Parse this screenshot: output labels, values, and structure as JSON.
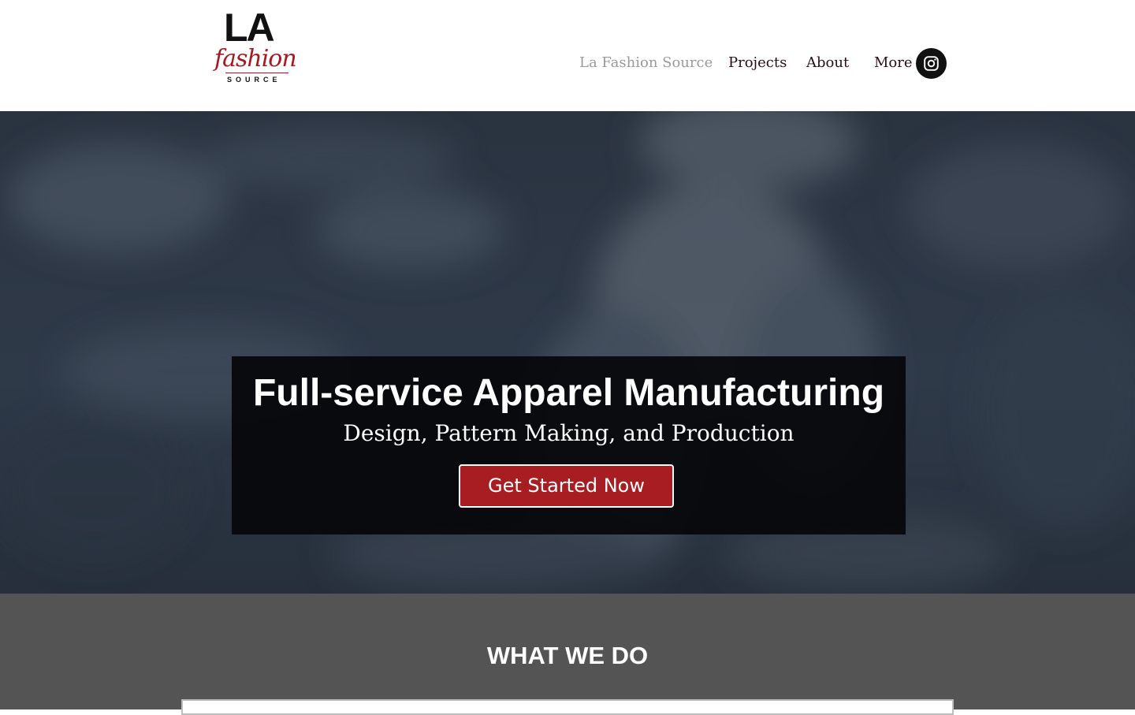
{
  "header": {
    "logo": {
      "la": "LA",
      "fashion": "fashion",
      "source": "SOURCE"
    },
    "nav": [
      {
        "label": "La Fashion Source",
        "active": true
      },
      {
        "label": "Projects",
        "active": false
      },
      {
        "label": "About",
        "active": false
      },
      {
        "label": "More",
        "active": false
      }
    ],
    "social_icon": "instagram-icon"
  },
  "hero": {
    "title": "Full-service Apparel Manufacturing",
    "subtitle": "Design, Pattern Making, and Production",
    "cta_label": "Get Started Now"
  },
  "what_we_do": {
    "title": "WHAT WE DO"
  },
  "colors": {
    "brand_red": "#a71d21",
    "nav_text": "#2b0e14",
    "nav_active": "#9a9a9a",
    "section_bg": "#545454"
  }
}
